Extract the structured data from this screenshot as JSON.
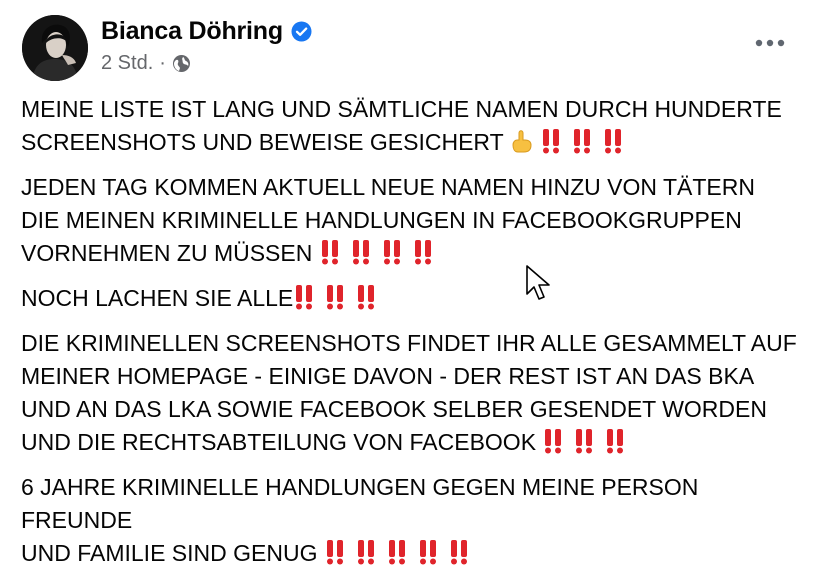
{
  "post": {
    "author": "Bianca Döhring",
    "verified": true,
    "time": "2 Std.",
    "separator": "·",
    "privacy_icon": "globe-icon",
    "menu_icon": "more-horizontal-icon",
    "accent_color": "#1877f2",
    "paragraphs": [
      {
        "text": "MEINE LISTE IST LANG UND SÄMTLICHE NAMEN DURCH HUNDERTE\nSCREENSHOTS UND BEWEISE GESICHERT",
        "emojis": [
          "☝",
          "‼",
          "‼",
          "‼"
        ]
      },
      {
        "text": "JEDEN TAG KOMMEN AKTUELL NEUE NAMEN HINZU VON TÄTERN\nDIE MEINEN KRIMINELLE HANDLUNGEN IN FACEBOOKGRUPPEN\nVORNEHMEN ZU MÜSSEN",
        "emojis": [
          "‼",
          "‼",
          "‼",
          "‼"
        ]
      },
      {
        "text": "NOCH LACHEN SIE ALLE",
        "emojis": [
          "‼",
          "‼",
          "‼"
        ]
      },
      {
        "text": "DIE KRIMINELLEN SCREENSHOTS FINDET IHR ALLE GESAMMELT AUF\nMEINER HOMEPAGE - EINIGE DAVON - DER REST IST AN DAS BKA\nUND AN DAS LKA SOWIE FACEBOOK SELBER GESENDET WORDEN\nUND DIE RECHTSABTEILUNG VON FACEBOOK",
        "emojis": [
          "‼",
          "‼",
          "‼"
        ]
      },
      {
        "text": "6 JAHRE KRIMINELLE HANDLUNGEN GEGEN MEINE PERSON FREUNDE\nUND FAMILIE SIND GENUG",
        "emojis": [
          "‼",
          "‼",
          "‼",
          "‼",
          "‼"
        ]
      }
    ]
  }
}
